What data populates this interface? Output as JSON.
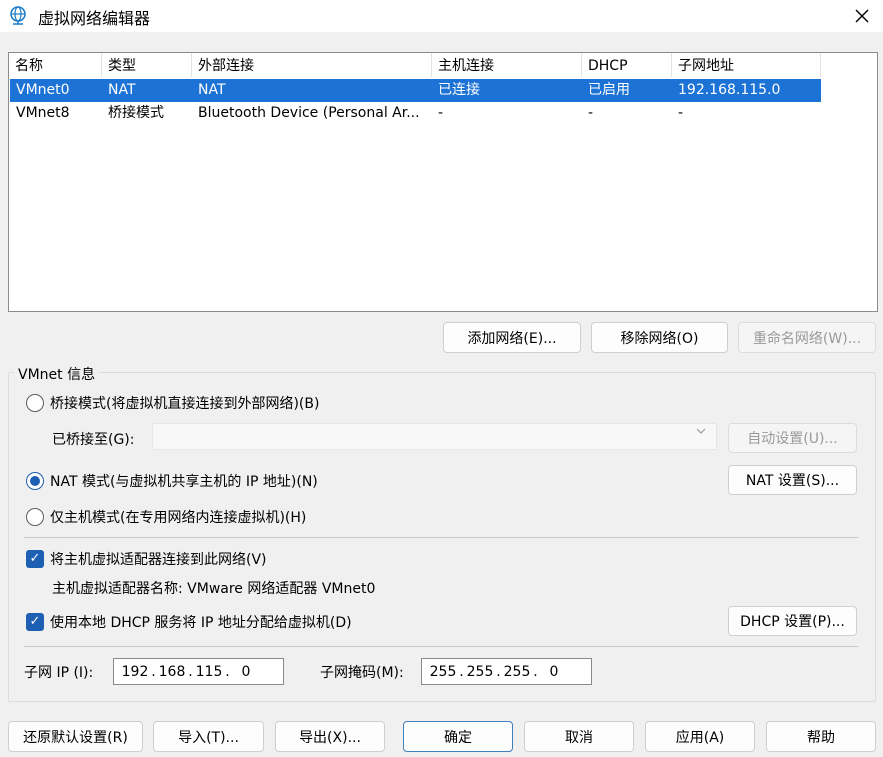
{
  "window": {
    "title": "虚拟网络编辑器"
  },
  "table": {
    "headers": [
      "名称",
      "类型",
      "外部连接",
      "主机连接",
      "DHCP",
      "子网地址"
    ],
    "rows": [
      [
        "VMnet0",
        "NAT",
        "NAT",
        "已连接",
        "已启用",
        "192.168.115.0"
      ],
      [
        "VMnet8",
        "桥接模式",
        "Bluetooth Device (Personal Ar...",
        "-",
        "-",
        "-"
      ]
    ],
    "selected_row": 0
  },
  "net_buttons": {
    "add": "添加网络(E)...",
    "remove": "移除网络(O)",
    "rename": "重命名网络(W)..."
  },
  "vmnet_info": {
    "group_label": "VMnet 信息",
    "bridge_mode": "桥接模式(将虚拟机直接连接到外部网络)(B)",
    "bridged_to_label": "已桥接至(G):",
    "bridged_to_value": "",
    "auto_settings": "自动设置(U)...",
    "nat_mode": "NAT 模式(与虚拟机共享主机的 IP 地址)(N)",
    "nat_settings": "NAT 设置(S)...",
    "host_only": "仅主机模式(在专用网络内连接虚拟机)(H)",
    "selected_mode": "nat",
    "connect_adapter": "将主机虚拟适配器连接到此网络(V)",
    "connect_adapter_checked": true,
    "adapter_name": "主机虚拟适配器名称: VMware 网络适配器 VMnet0",
    "use_dhcp": "使用本地 DHCP 服务将 IP 地址分配给虚拟机(D)",
    "use_dhcp_checked": true,
    "dhcp_settings": "DHCP 设置(P)...",
    "subnet_ip_label": "子网 IP (I):",
    "subnet_ip": [
      "192",
      "168",
      "115",
      "0"
    ],
    "subnet_mask_label": "子网掩码(M):",
    "subnet_mask": [
      "255",
      "255",
      "255",
      "0"
    ],
    "ip_dot": "."
  },
  "footer": {
    "restore": "还原默认设置(R)",
    "import": "导入(T)...",
    "export": "导出(X)...",
    "ok": "确定",
    "cancel": "取消",
    "apply": "应用(A)",
    "help": "帮助"
  },
  "colors": {
    "selection": "#1d73d5",
    "accent": "#1d5fb3"
  },
  "icons": {
    "title": "network-globe-icon",
    "close": "close-icon",
    "dropdown": "chevron-down-icon",
    "check": "checkmark-icon"
  }
}
